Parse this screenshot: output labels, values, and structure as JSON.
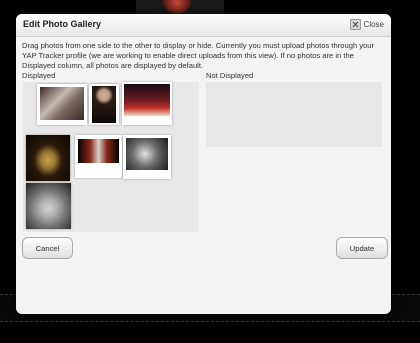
{
  "dialog": {
    "title": "Edit Photo Gallery",
    "close_label": "Close",
    "instructions": "Drag photos from one side to the other to display or hide. Currently you must upload photos through your YAP Tracker profile (we are working to enable direct uploads from this view). If no photos are in the Displayed column, all photos are displayed by default.",
    "displayed_label": "Displayed",
    "not_displayed_label": "Not Displayed",
    "cancel_label": "Cancel",
    "update_label": "Update"
  },
  "displayed_photos": [
    {
      "name": "opera-ensemble-photo",
      "colors": [
        "#7a6a62",
        "#c7b9b0",
        "#3a2a24"
      ]
    },
    {
      "name": "singer-portrait-photo",
      "colors": [
        "#2a1a14",
        "#b79a84",
        "#0d0806"
      ]
    },
    {
      "name": "stage-scene-photo",
      "colors": [
        "#1a0a14",
        "#c0302a",
        "#f0d8c0"
      ]
    },
    {
      "name": "costumed-performer-photo",
      "colors": [
        "#0a0604",
        "#9a7a34",
        "#2a1a0a"
      ]
    },
    {
      "name": "duet-on-stage-photo",
      "colors": [
        "#050202",
        "#d8d0c8",
        "#8a2a1a"
      ]
    },
    {
      "name": "bw-headshot-photo",
      "colors": [
        "#e0e0e0",
        "#6a6a6a",
        "#1a1a1a"
      ]
    },
    {
      "name": "bw-closeup-headshot-photo",
      "colors": [
        "#b0b0b0",
        "#7a7a7a",
        "#202020"
      ]
    }
  ],
  "hidden_photos": []
}
